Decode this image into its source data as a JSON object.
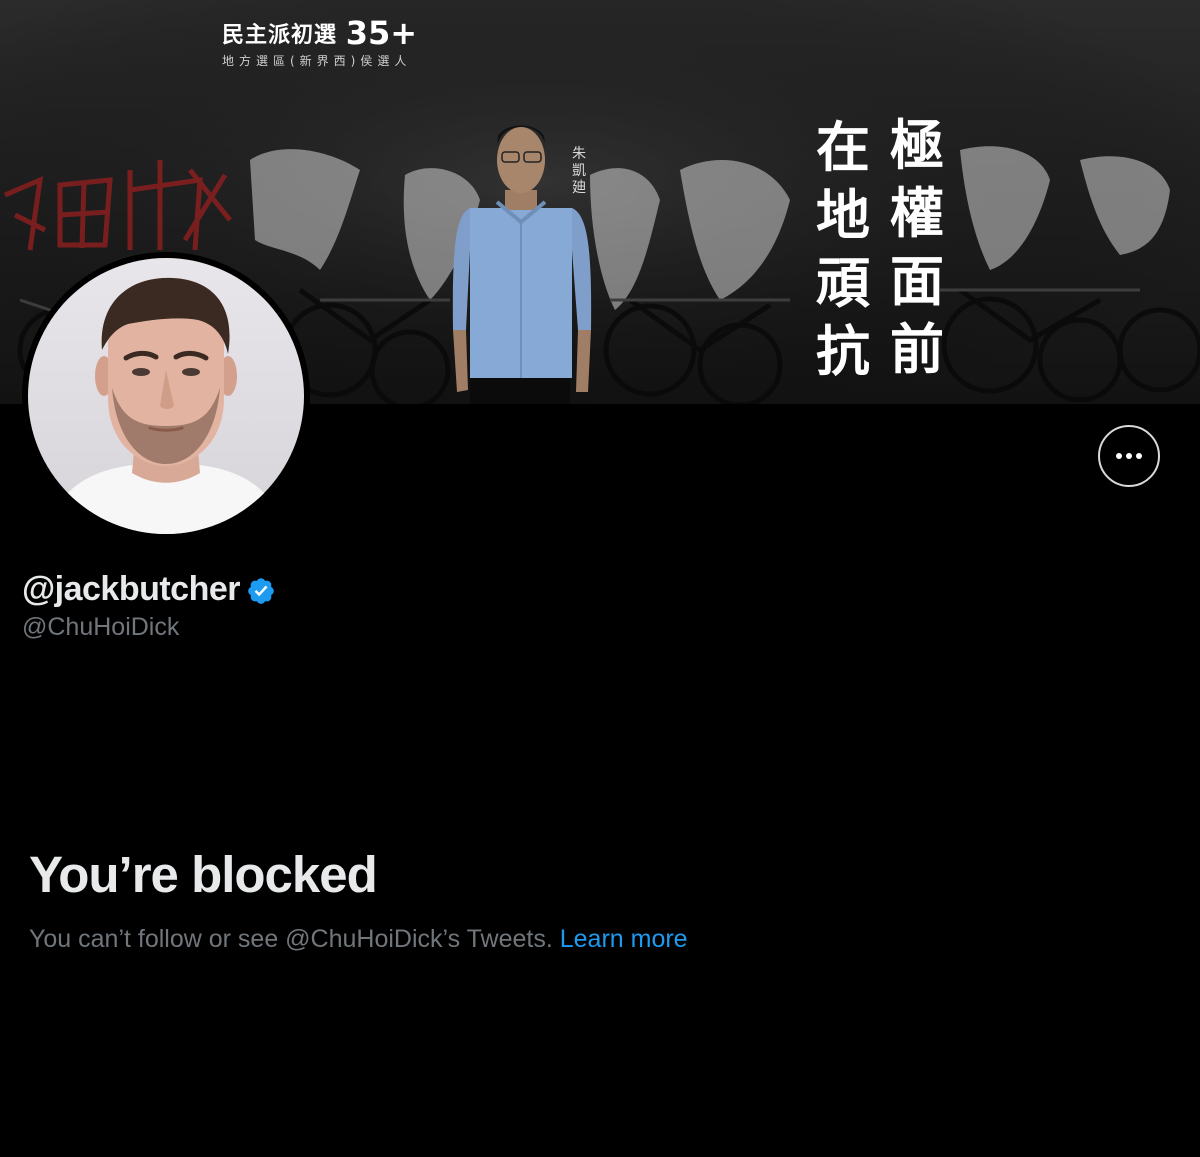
{
  "banner": {
    "caption_main": "民主派初選",
    "caption_number": "35+",
    "caption_sub": "地方選區(新界西)侯選人",
    "vertical_text_col1": "在地頑抗",
    "vertical_text_col2": "極權面前",
    "person_name_vertical": "朱凱廸"
  },
  "profile": {
    "display_name": "@jackbutcher",
    "handle": "@ChuHoiDick",
    "verified_icon": "verified-badge-icon",
    "more_icon": "more-options-icon"
  },
  "blocked": {
    "title": "You’re blocked",
    "message": "You can’t follow or see @ChuHoiDick’s Tweets.",
    "learn_more": "Learn more"
  },
  "colors": {
    "background": "#000000",
    "text_primary": "#e7e9ea",
    "text_secondary": "#71767b",
    "link": "#1d9bf0",
    "verified": "#1d9bf0"
  }
}
